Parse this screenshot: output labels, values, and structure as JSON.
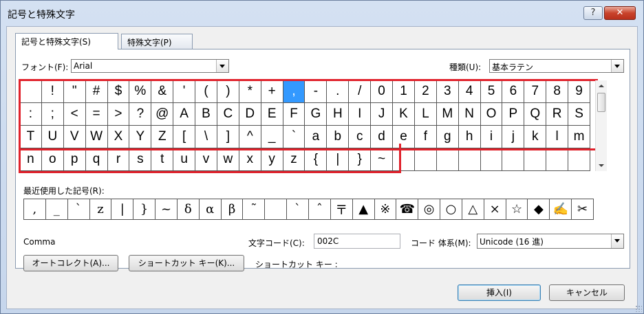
{
  "window": {
    "title": "記号と特殊文字"
  },
  "titlebar_buttons": {
    "help": "?",
    "close": "✕"
  },
  "tabs": [
    {
      "label": "記号と特殊文字(S)"
    },
    {
      "label": "特殊文字(P)"
    }
  ],
  "font": {
    "label": "フォント(F):",
    "value": "Arial"
  },
  "subset": {
    "label": "種類(U):",
    "value": "基本ラテン"
  },
  "symbol_grid": [
    [
      " ",
      "!",
      "\"",
      "#",
      "$",
      "%",
      "&",
      "'",
      "(",
      ")",
      "*",
      "+",
      ",",
      "-",
      ".",
      "/",
      "0",
      "1",
      "2",
      "3",
      "4",
      "5",
      "6",
      "7",
      "8",
      "9"
    ],
    [
      ":",
      ";",
      "<",
      "=",
      ">",
      "?",
      "@",
      "A",
      "B",
      "C",
      "D",
      "E",
      "F",
      "G",
      "H",
      "I",
      "J",
      "K",
      "L",
      "M",
      "N",
      "O",
      "P",
      "Q",
      "R",
      "S"
    ],
    [
      "T",
      "U",
      "V",
      "W",
      "X",
      "Y",
      "Z",
      "[",
      "\\",
      "]",
      "^",
      "_",
      "`",
      "a",
      "b",
      "c",
      "d",
      "e",
      "f",
      "g",
      "h",
      "i",
      "j",
      "k",
      "l",
      "m"
    ],
    [
      "n",
      "o",
      "p",
      "q",
      "r",
      "s",
      "t",
      "u",
      "v",
      "w",
      "x",
      "y",
      "z",
      "{",
      "|",
      "}",
      "~",
      "",
      "",
      "",
      "",
      "",
      "",
      "",
      "",
      ""
    ]
  ],
  "selected_symbol": ",",
  "recent": {
    "label": "最近使用した記号(R):",
    "symbols": [
      ",",
      "_",
      "`",
      "z",
      "|",
      "}",
      "~",
      "δ",
      "α",
      "β",
      "˜",
      "",
      "ˋ",
      "ˆ",
      "〒",
      "▲",
      "※",
      "☎",
      "◎",
      "○",
      "△",
      "×",
      "☆",
      "◆",
      "✍",
      "✂"
    ]
  },
  "char_name": "Comma",
  "char_code": {
    "label": "文字コード(C):",
    "value": "002C"
  },
  "code_system": {
    "label": "コード 体系(M):",
    "value": "Unicode (16 進)"
  },
  "buttons": {
    "autocorrect": "オートコレクト(A)...",
    "shortcut_key": "ショートカット キー(K)...",
    "insert": "挿入(I)",
    "cancel": "キャンセル"
  },
  "shortcut_label": "ショートカット キー :",
  "colors": {
    "selection": "#3399ff",
    "highlight_frame": "#e0212b"
  }
}
